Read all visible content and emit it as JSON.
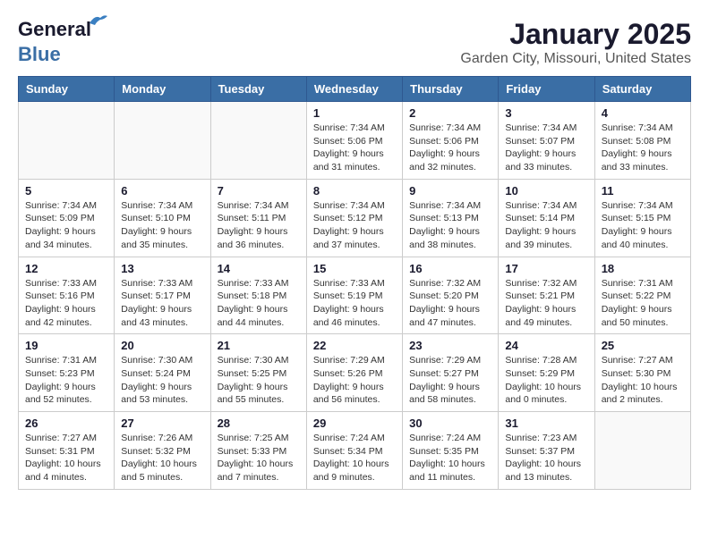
{
  "header": {
    "logo_line1": "General",
    "logo_line2": "Blue",
    "month": "January 2025",
    "location": "Garden City, Missouri, United States"
  },
  "weekdays": [
    "Sunday",
    "Monday",
    "Tuesday",
    "Wednesday",
    "Thursday",
    "Friday",
    "Saturday"
  ],
  "weeks": [
    [
      {
        "day": "",
        "info": ""
      },
      {
        "day": "",
        "info": ""
      },
      {
        "day": "",
        "info": ""
      },
      {
        "day": "1",
        "info": "Sunrise: 7:34 AM\nSunset: 5:06 PM\nDaylight: 9 hours and 31 minutes."
      },
      {
        "day": "2",
        "info": "Sunrise: 7:34 AM\nSunset: 5:06 PM\nDaylight: 9 hours and 32 minutes."
      },
      {
        "day": "3",
        "info": "Sunrise: 7:34 AM\nSunset: 5:07 PM\nDaylight: 9 hours and 33 minutes."
      },
      {
        "day": "4",
        "info": "Sunrise: 7:34 AM\nSunset: 5:08 PM\nDaylight: 9 hours and 33 minutes."
      }
    ],
    [
      {
        "day": "5",
        "info": "Sunrise: 7:34 AM\nSunset: 5:09 PM\nDaylight: 9 hours and 34 minutes."
      },
      {
        "day": "6",
        "info": "Sunrise: 7:34 AM\nSunset: 5:10 PM\nDaylight: 9 hours and 35 minutes."
      },
      {
        "day": "7",
        "info": "Sunrise: 7:34 AM\nSunset: 5:11 PM\nDaylight: 9 hours and 36 minutes."
      },
      {
        "day": "8",
        "info": "Sunrise: 7:34 AM\nSunset: 5:12 PM\nDaylight: 9 hours and 37 minutes."
      },
      {
        "day": "9",
        "info": "Sunrise: 7:34 AM\nSunset: 5:13 PM\nDaylight: 9 hours and 38 minutes."
      },
      {
        "day": "10",
        "info": "Sunrise: 7:34 AM\nSunset: 5:14 PM\nDaylight: 9 hours and 39 minutes."
      },
      {
        "day": "11",
        "info": "Sunrise: 7:34 AM\nSunset: 5:15 PM\nDaylight: 9 hours and 40 minutes."
      }
    ],
    [
      {
        "day": "12",
        "info": "Sunrise: 7:33 AM\nSunset: 5:16 PM\nDaylight: 9 hours and 42 minutes."
      },
      {
        "day": "13",
        "info": "Sunrise: 7:33 AM\nSunset: 5:17 PM\nDaylight: 9 hours and 43 minutes."
      },
      {
        "day": "14",
        "info": "Sunrise: 7:33 AM\nSunset: 5:18 PM\nDaylight: 9 hours and 44 minutes."
      },
      {
        "day": "15",
        "info": "Sunrise: 7:33 AM\nSunset: 5:19 PM\nDaylight: 9 hours and 46 minutes."
      },
      {
        "day": "16",
        "info": "Sunrise: 7:32 AM\nSunset: 5:20 PM\nDaylight: 9 hours and 47 minutes."
      },
      {
        "day": "17",
        "info": "Sunrise: 7:32 AM\nSunset: 5:21 PM\nDaylight: 9 hours and 49 minutes."
      },
      {
        "day": "18",
        "info": "Sunrise: 7:31 AM\nSunset: 5:22 PM\nDaylight: 9 hours and 50 minutes."
      }
    ],
    [
      {
        "day": "19",
        "info": "Sunrise: 7:31 AM\nSunset: 5:23 PM\nDaylight: 9 hours and 52 minutes."
      },
      {
        "day": "20",
        "info": "Sunrise: 7:30 AM\nSunset: 5:24 PM\nDaylight: 9 hours and 53 minutes."
      },
      {
        "day": "21",
        "info": "Sunrise: 7:30 AM\nSunset: 5:25 PM\nDaylight: 9 hours and 55 minutes."
      },
      {
        "day": "22",
        "info": "Sunrise: 7:29 AM\nSunset: 5:26 PM\nDaylight: 9 hours and 56 minutes."
      },
      {
        "day": "23",
        "info": "Sunrise: 7:29 AM\nSunset: 5:27 PM\nDaylight: 9 hours and 58 minutes."
      },
      {
        "day": "24",
        "info": "Sunrise: 7:28 AM\nSunset: 5:29 PM\nDaylight: 10 hours and 0 minutes."
      },
      {
        "day": "25",
        "info": "Sunrise: 7:27 AM\nSunset: 5:30 PM\nDaylight: 10 hours and 2 minutes."
      }
    ],
    [
      {
        "day": "26",
        "info": "Sunrise: 7:27 AM\nSunset: 5:31 PM\nDaylight: 10 hours and 4 minutes."
      },
      {
        "day": "27",
        "info": "Sunrise: 7:26 AM\nSunset: 5:32 PM\nDaylight: 10 hours and 5 minutes."
      },
      {
        "day": "28",
        "info": "Sunrise: 7:25 AM\nSunset: 5:33 PM\nDaylight: 10 hours and 7 minutes."
      },
      {
        "day": "29",
        "info": "Sunrise: 7:24 AM\nSunset: 5:34 PM\nDaylight: 10 hours and 9 minutes."
      },
      {
        "day": "30",
        "info": "Sunrise: 7:24 AM\nSunset: 5:35 PM\nDaylight: 10 hours and 11 minutes."
      },
      {
        "day": "31",
        "info": "Sunrise: 7:23 AM\nSunset: 5:37 PM\nDaylight: 10 hours and 13 minutes."
      },
      {
        "day": "",
        "info": ""
      }
    ]
  ]
}
